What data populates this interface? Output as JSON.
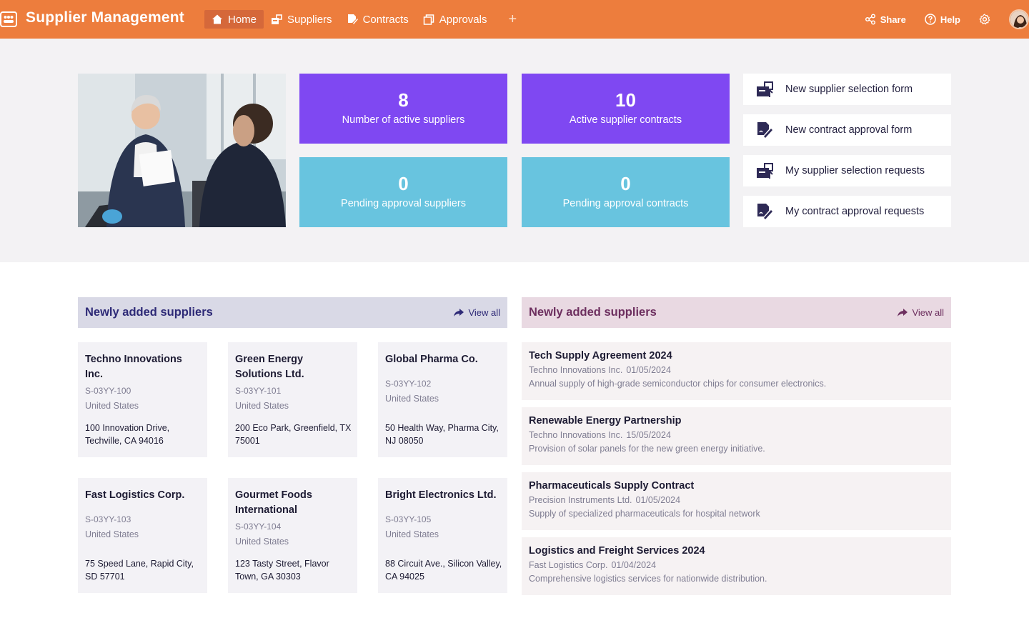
{
  "app": {
    "title": "Supplier Management"
  },
  "nav": {
    "items": [
      {
        "label": "Home",
        "icon": "home-icon"
      },
      {
        "label": "Suppliers",
        "icon": "suppliers-icon"
      },
      {
        "label": "Contracts",
        "icon": "contracts-icon"
      },
      {
        "label": "Approvals",
        "icon": "approvals-icon"
      }
    ],
    "add_label": "+"
  },
  "tools": {
    "share": "Share",
    "help": "Help"
  },
  "stats": [
    {
      "value": "8",
      "label": "Number of active suppliers"
    },
    {
      "value": "10",
      "label": "Active supplier contracts"
    },
    {
      "value": "0",
      "label": "Pending approval suppliers"
    },
    {
      "value": "0",
      "label": "Pending approval contracts"
    }
  ],
  "quick_links": [
    {
      "label": "New supplier selection form",
      "icon": "supplier-form-icon"
    },
    {
      "label": "New contract approval form",
      "icon": "contract-form-icon"
    },
    {
      "label": "My supplier selection requests",
      "icon": "supplier-form-icon"
    },
    {
      "label": "My contract approval requests",
      "icon": "contract-form-icon"
    }
  ],
  "suppliers_panel": {
    "title": "Newly added suppliers",
    "view_all": "View all",
    "suppliers": [
      {
        "name": "Techno Innovations Inc.",
        "code": "S-03YY-100",
        "country": "United States",
        "address": "100 Innovation Drive, Techville, CA 94016"
      },
      {
        "name": "Green Energy Solutions Ltd.",
        "code": "S-03YY-101",
        "country": "United States",
        "address": "200 Eco Park, Greenfield, TX 75001"
      },
      {
        "name": "Global Pharma Co.",
        "code": "S-03YY-102",
        "country": "United States",
        "address": "50 Health Way, Pharma City, NJ 08050"
      },
      {
        "name": "Fast Logistics Corp.",
        "code": "S-03YY-103",
        "country": "United States",
        "address": "75 Speed Lane, Rapid City, SD 57701"
      },
      {
        "name": "Gourmet Foods International",
        "code": "S-03YY-104",
        "country": "United States",
        "address": "123 Tasty Street, Flavor Town, GA 30303"
      },
      {
        "name": "Bright Electronics Ltd.",
        "code": "S-03YY-105",
        "country": "United States",
        "address": "88 Circuit Ave., Silicon Valley, CA 94025"
      }
    ]
  },
  "contracts_panel": {
    "title": "Newly added suppliers",
    "view_all": "View all",
    "contracts": [
      {
        "title": "Tech Supply Agreement 2024",
        "supplier": "Techno Innovations Inc.",
        "date": "01/05/2024",
        "description": "Annual supply of high-grade semiconductor chips for consumer electronics."
      },
      {
        "title": "Renewable Energy Partnership",
        "supplier": "Techno Innovations Inc.",
        "date": "15/05/2024",
        "description": "Provision of solar panels for the new green energy initiative."
      },
      {
        "title": "Pharmaceuticals Supply Contract",
        "supplier": "Precision Instruments Ltd.",
        "date": "01/05/2024",
        "description": "Supply of specialized pharmaceuticals for hospital network"
      },
      {
        "title": "Logistics and Freight Services 2024",
        "supplier": "Fast Logistics Corp.",
        "date": "01/04/2024",
        "description": "Comprehensive logistics services for nationwide distribution."
      }
    ]
  },
  "colors": {
    "topbar": "#ed7d3d",
    "stat_purple": "#7f48f2",
    "stat_blue": "#68c4df"
  }
}
